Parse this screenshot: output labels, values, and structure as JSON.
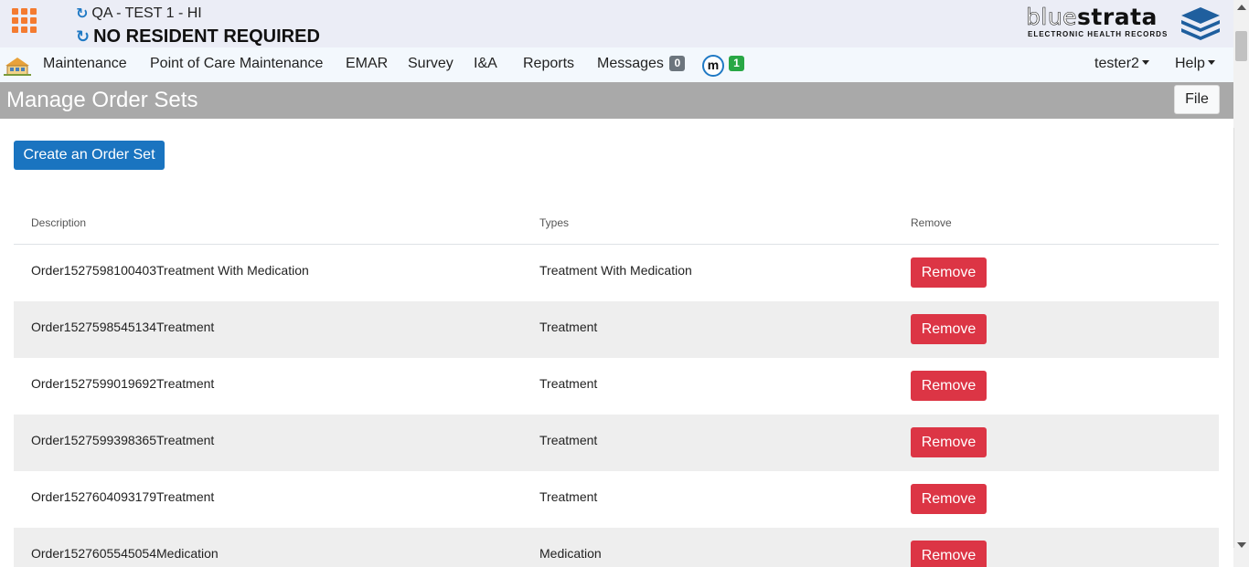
{
  "header": {
    "facility": "QA - TEST 1 - HI",
    "resident": "NO RESIDENT REQUIRED",
    "logo": {
      "word_light": "blue",
      "word_bold": "strata",
      "tagline": "ELECTRONIC HEALTH RECORDS"
    }
  },
  "nav": {
    "items": [
      {
        "label": "Maintenance"
      },
      {
        "label": "Point of Care Maintenance"
      },
      {
        "label": "EMAR"
      },
      {
        "label": "Survey"
      },
      {
        "label": "I&A"
      },
      {
        "label": "Reports"
      },
      {
        "label": "Messages",
        "badge": "0"
      }
    ],
    "m_icon": "m",
    "m_badge": "1",
    "user": "tester2",
    "help": "Help"
  },
  "page": {
    "title": "Manage Order Sets",
    "file_button": "File",
    "create_button": "Create an Order Set"
  },
  "table": {
    "columns": [
      "Description",
      "Types",
      "Remove"
    ],
    "rows": [
      {
        "description": "Order1527598100403Treatment With Medication",
        "type": "Treatment With Medication",
        "action": "Remove"
      },
      {
        "description": "Order1527598545134Treatment",
        "type": "Treatment",
        "action": "Remove"
      },
      {
        "description": "Order1527599019692Treatment",
        "type": "Treatment",
        "action": "Remove"
      },
      {
        "description": "Order1527599398365Treatment",
        "type": "Treatment",
        "action": "Remove"
      },
      {
        "description": "Order1527604093179Treatment",
        "type": "Treatment",
        "action": "Remove"
      },
      {
        "description": "Order1527605545054Medication",
        "type": "Medication",
        "action": "Remove"
      }
    ]
  },
  "colors": {
    "apps_icon": "#f47b30",
    "primary": "#1a74c0",
    "danger": "#dc3545",
    "header_bg": "#a9a9a9",
    "messages_badge": "#6c757d",
    "m_badge": "#28a745"
  }
}
